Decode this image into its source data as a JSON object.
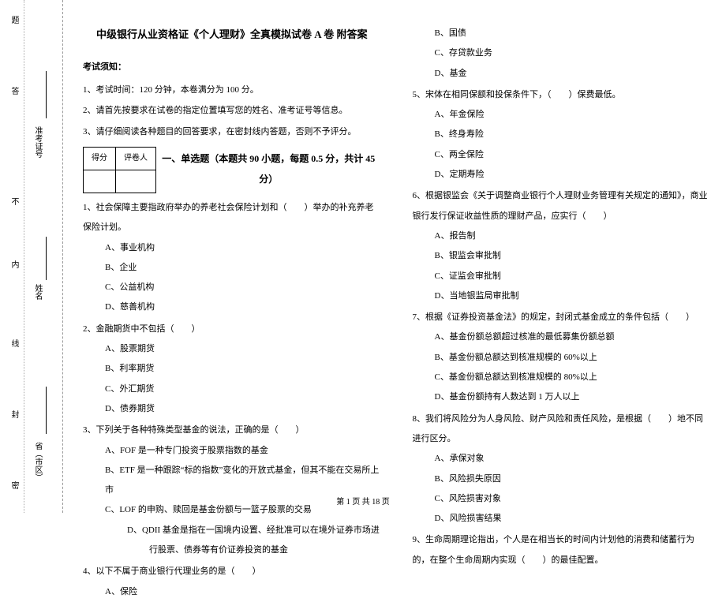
{
  "binding": {
    "labels": [
      "省（市区）",
      "姓名",
      "准考证号"
    ],
    "markers": [
      "密",
      "封",
      "线",
      "内",
      "不",
      "答",
      "题"
    ]
  },
  "title": "中级银行从业资格证《个人理财》全真模拟试卷 A 卷 附答案",
  "notice_header": "考试须知：",
  "notices": [
    "1、考试时间：120 分钟，本卷满分为 100 分。",
    "2、请首先按要求在试卷的指定位置填写您的姓名、准考证号等信息。",
    "3、请仔细阅读各种题目的回答要求，在密封线内答题，否则不予评分。"
  ],
  "score_table": {
    "h1": "得分",
    "h2": "评卷人"
  },
  "section1_title": "一、单选题（本题共 90 小题，每题 0.5 分，共计 45 分）",
  "questions_left": [
    {
      "stem": "1、社会保障主要指政府举办的养老社会保险计划和（　　）举办的补充养老保险计划。",
      "options": [
        "A、事业机构",
        "B、企业",
        "C、公益机构",
        "D、慈善机构"
      ]
    },
    {
      "stem": "2、金融期货中不包括（　　）",
      "options": [
        "A、股票期货",
        "B、利率期货",
        "C、外汇期货",
        "D、债券期货"
      ]
    },
    {
      "stem": "3、下列关于各种特殊类型基金的说法，正确的是（　　）",
      "options": [
        "A、FOF 是一种专门投资于股票指数的基金",
        "B、ETF 是一种跟踪“标的指数”变化的开放式基金，但其不能在交易所上市",
        "C、LOF 的申购、赎回是基金份额与一篮子股票的交易",
        "D、QDII 基金是指在一国境内设置、经批准可以在境外证券市场进行股票、债券等有价证券投资的基金"
      ],
      "wrap_last": true
    },
    {
      "stem": "4、以下不属于商业银行代理业务的是（　　）",
      "options": [
        "A、保险"
      ]
    }
  ],
  "questions_right_pre_options": [
    "B、国债",
    "C、存贷款业务",
    "D、基金"
  ],
  "questions_right": [
    {
      "stem": "5、宋体在相同保额和投保条件下，（　　）保费最低。",
      "options": [
        "A、年金保险",
        "B、终身寿险",
        "C、两全保险",
        "D、定期寿险"
      ]
    },
    {
      "stem": "6、根据银监会《关于调整商业银行个人理财业务管理有关规定的通知》，商业银行发行保证收益性质的理财产品，应实行（　　）",
      "options": [
        "A、报告制",
        "B、银监会审批制",
        "C、证监会审批制",
        "D、当地银监局审批制"
      ],
      "wrap_first": true
    },
    {
      "stem": "7、根据《证券投资基金法》的规定，封闭式基金成立的条件包括（　　）",
      "options": [
        "A、基金份额总额超过核准的最低募集份额总额",
        "B、基金份额总额达到核准规模的 60%以上",
        "C、基金份额总额达到核准规模的 80%以上",
        "D、基金份额持有人数达到 1 万人以上"
      ]
    },
    {
      "stem": "8、我们将风险分为人身风险、财产风险和责任风险，是根据（　　）地不同进行区分。",
      "options": [
        "A、承保对象",
        "B、风险损失原因",
        "C、风险损害对象",
        "D、风险损害结果"
      ]
    },
    {
      "stem": "9、生命周期理论指出，个人是在相当长的时间内计划他的消费和储蓄行为的，在整个生命周期内实现（　　）的最佳配置。",
      "options": [],
      "wrap_first": true
    }
  ],
  "footer": "第 1 页 共 18 页"
}
